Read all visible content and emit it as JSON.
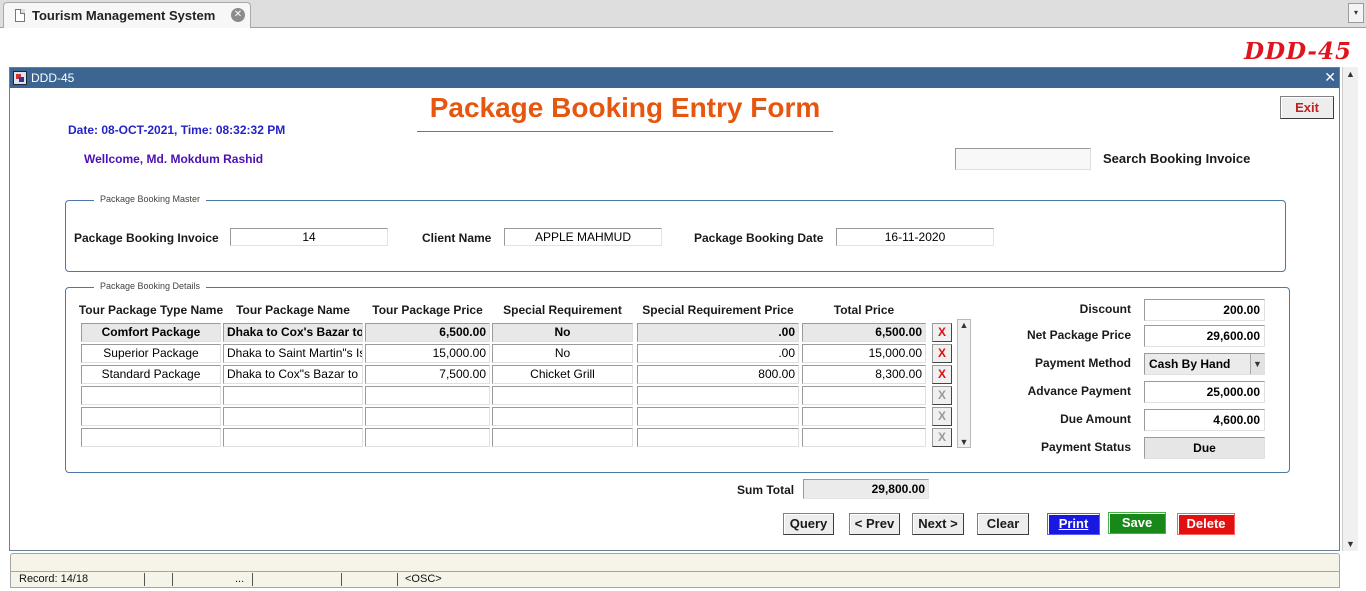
{
  "browser": {
    "tab_title": "Tourism Management System",
    "tab_close_glyph": "⊗",
    "menu_glyph": "▾"
  },
  "brand": "DDD-45",
  "window": {
    "title": "DDD-45",
    "close_glyph": "✕"
  },
  "form": {
    "title": "Package Booking Entry Form",
    "date_line": "Date: 08-OCT-2021,  Time:  08:32:32 PM",
    "welcome": "Wellcome, Md. Mokdum Rashid",
    "exit_label": "Exit",
    "search": {
      "value": "",
      "label": "Search Booking Invoice"
    }
  },
  "master": {
    "legend": "Package Booking Master",
    "invoice_label": "Package Booking Invoice",
    "invoice_value": "14",
    "client_label": "Client Name",
    "client_value": "APPLE MAHMUD",
    "date_label": "Package Booking Date",
    "date_value": "16-11-2020"
  },
  "details": {
    "legend": "Package Booking Details",
    "columns": [
      "Tour Package Type Name",
      "Tour Package Name",
      "Tour Package Price",
      "Special Requirement",
      "Special Requirement Price",
      "Total Price"
    ],
    "rows": [
      {
        "type": "Comfort Package",
        "name": "Dhaka to Cox's Bazar to",
        "price": "6,500.00",
        "special": "No",
        "special_price": ".00",
        "total": "6,500.00",
        "del": "X"
      },
      {
        "type": "Superior Package",
        "name": "Dhaka to Saint Martin\"s Is",
        "price": "15,000.00",
        "special": "No",
        "special_price": ".00",
        "total": "15,000.00",
        "del": "X"
      },
      {
        "type": "Standard Package",
        "name": "Dhaka to Cox\"s Bazar to I",
        "price": "7,500.00",
        "special": "Chicket Grill",
        "special_price": "800.00",
        "total": "8,300.00",
        "del": "X"
      },
      {
        "type": "",
        "name": "",
        "price": "",
        "special": "",
        "special_price": "",
        "total": "",
        "del": "X"
      },
      {
        "type": "",
        "name": "",
        "price": "",
        "special": "",
        "special_price": "",
        "total": "",
        "del": "X"
      },
      {
        "type": "",
        "name": "",
        "price": "",
        "special": "",
        "special_price": "",
        "total": "",
        "del": "X"
      }
    ],
    "scroll_up": "▲",
    "scroll_down": "▼"
  },
  "summary": {
    "discount_label": "Discount",
    "discount_value": "200.00",
    "net_label": "Net Package Price",
    "net_value": "29,600.00",
    "payment_method_label": "Payment Method",
    "payment_method_value": "Cash By Hand",
    "advance_label": "Advance Payment",
    "advance_value": "25,000.00",
    "due_label": "Due Amount",
    "due_value": "4,600.00",
    "status_label": "Payment Status",
    "status_value": "Due"
  },
  "sum_total": {
    "label": "Sum Total",
    "value": "29,800.00"
  },
  "buttons": {
    "query": "Query",
    "prev": "< Prev",
    "next": "Next >",
    "clear": "Clear",
    "print": "Print",
    "save": "Save",
    "delete": "Delete"
  },
  "statusbar": {
    "record": "Record: 14/18",
    "ellipsis": "...",
    "mode": "<OSC>"
  },
  "colors": {
    "title_orange": "#e6560f",
    "brand_red": "#e0141e",
    "titlebar_blue": "#3c6591",
    "group_border": "#4e78a8"
  }
}
